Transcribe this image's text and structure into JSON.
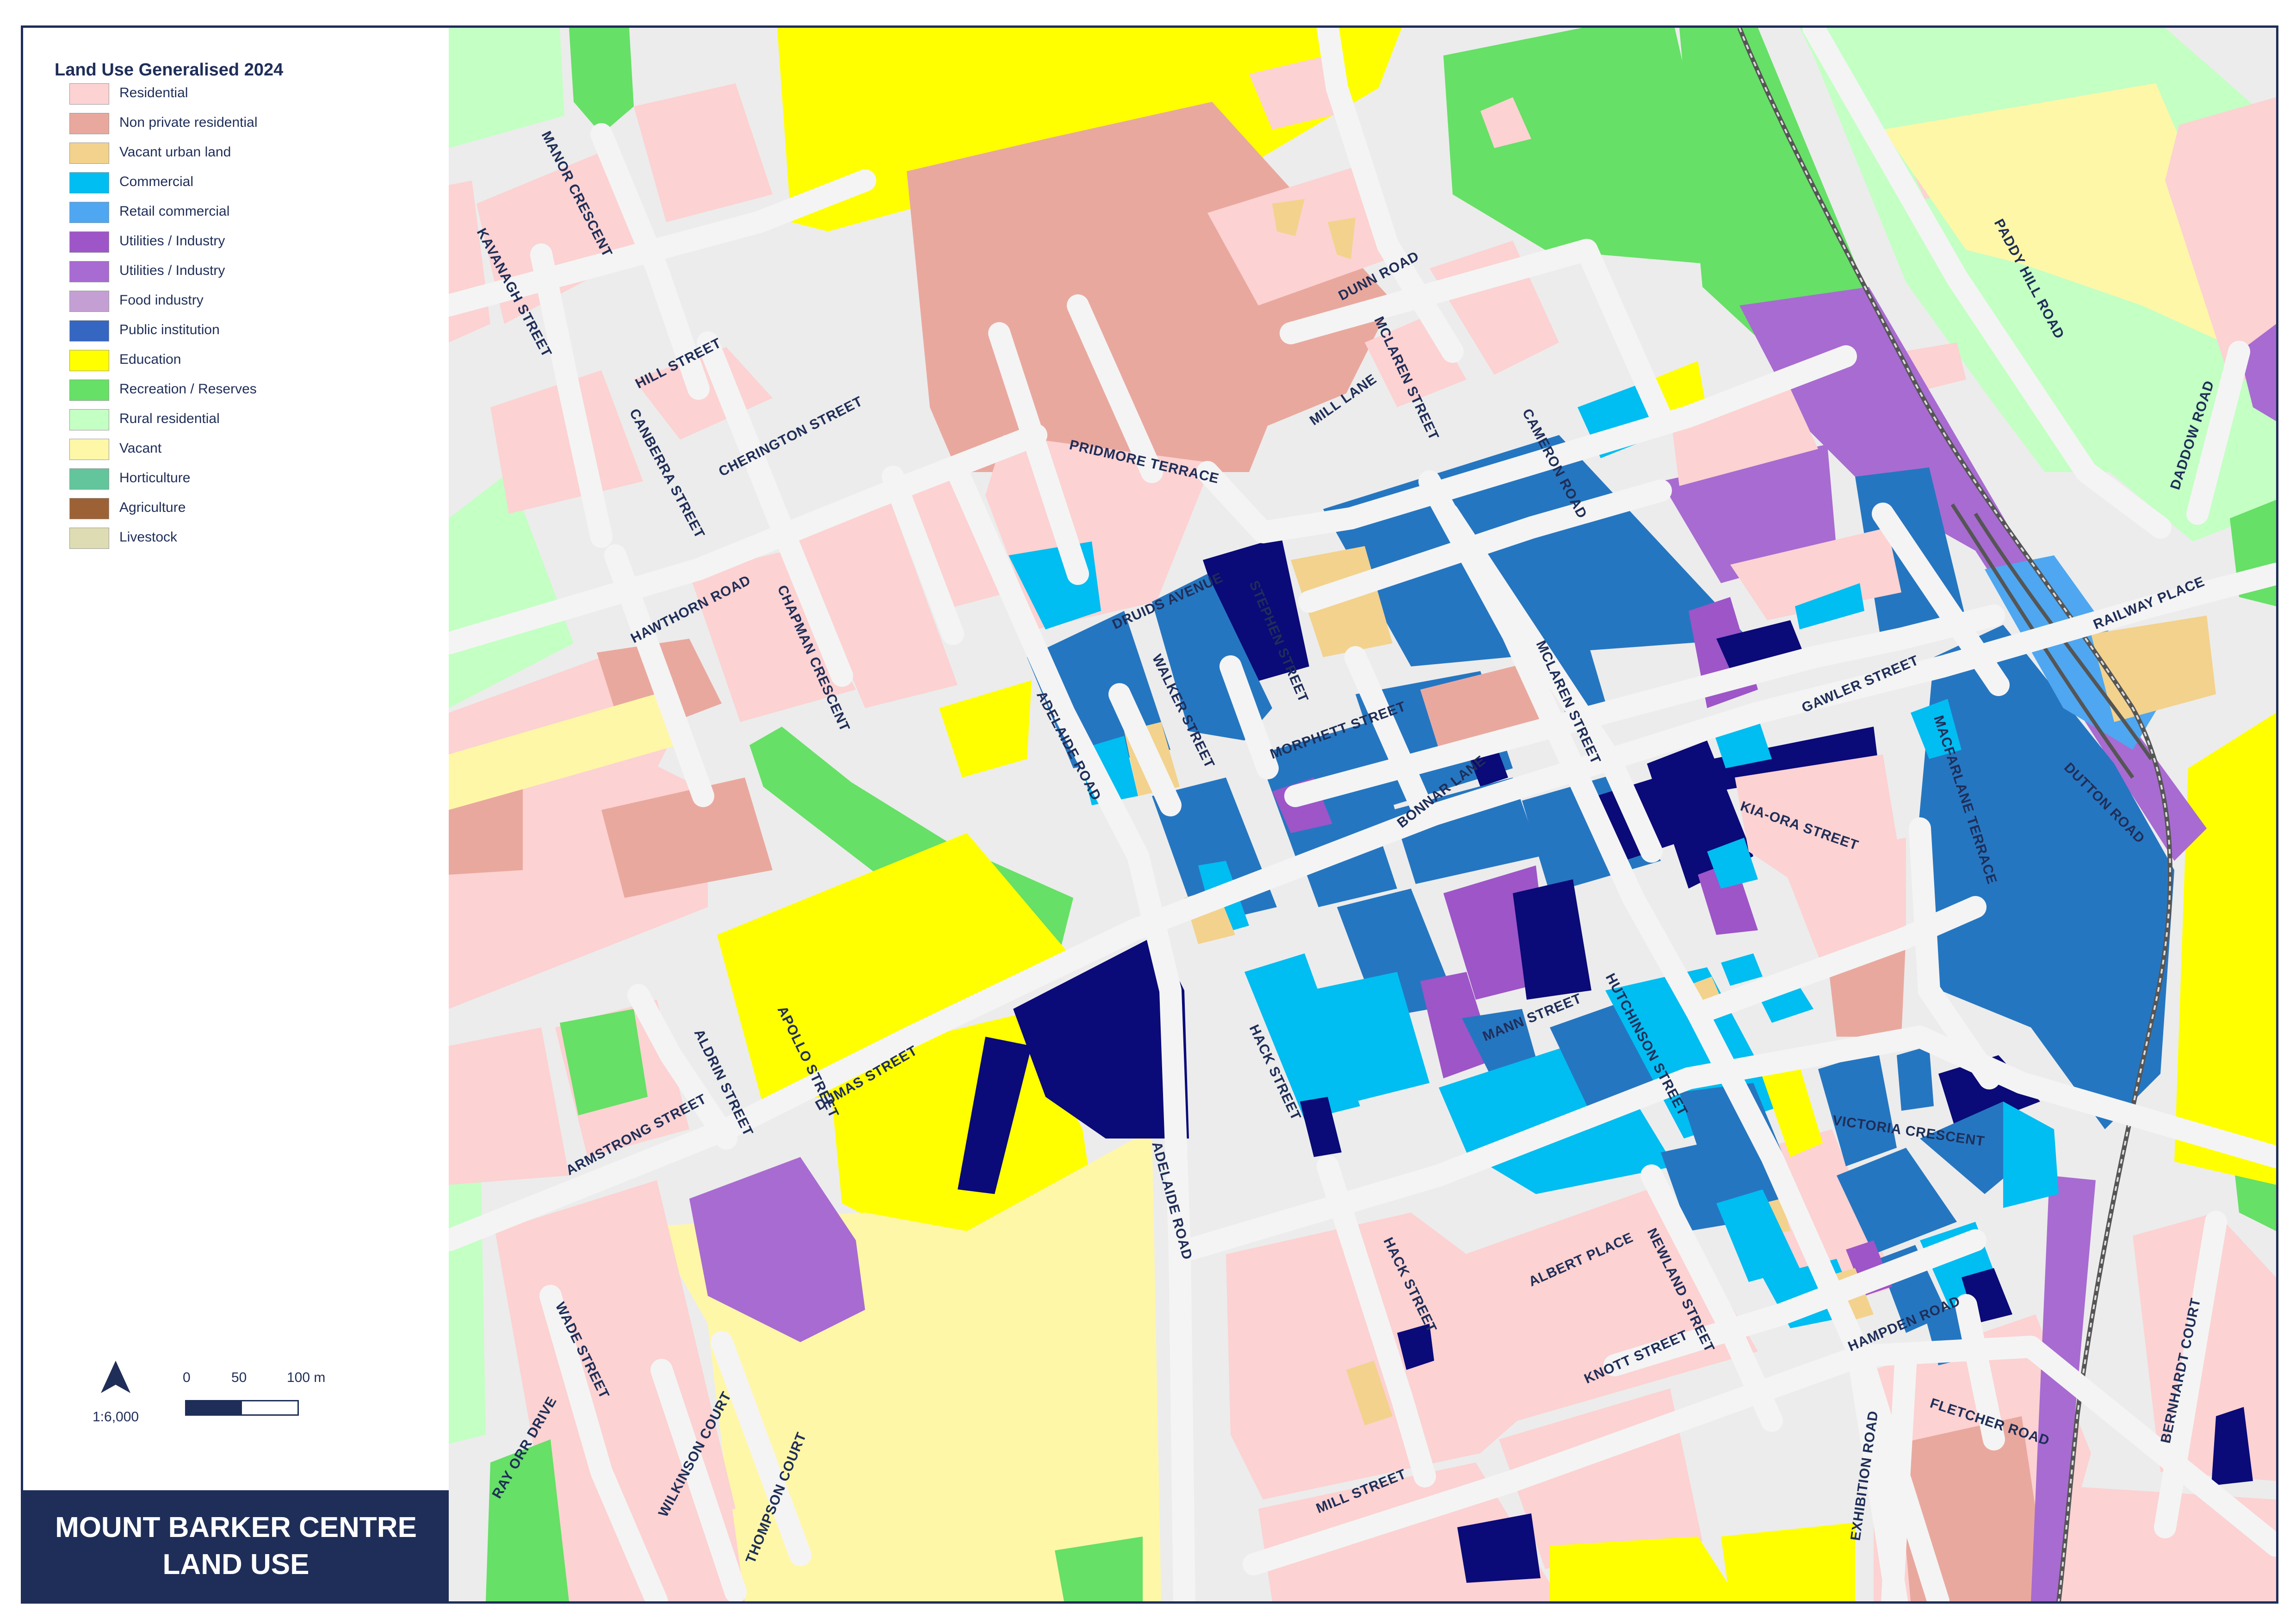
{
  "legend": {
    "title": "Land Use Generalised 2024",
    "items": [
      {
        "label": "Residential",
        "color": "#fcd2d2"
      },
      {
        "label": "Non private residential",
        "color": "#e9a89e"
      },
      {
        "label": "Vacant urban land",
        "color": "#f3d28d"
      },
      {
        "label": "Commercial",
        "color": "#00bdf2"
      },
      {
        "label": "Retail commercial",
        "color": "#4ea7f0"
      },
      {
        "label": "Utilities / Industry",
        "color": "#9d55c8"
      },
      {
        "label": "Utilities / Industry",
        "color": "#a86bd1"
      },
      {
        "label": "Food industry",
        "color": "#c49fd3"
      },
      {
        "label": "Public institution",
        "color": "#3566c1"
      },
      {
        "label": "Education",
        "color": "#ffff00"
      },
      {
        "label": "Recreation / Reserves",
        "color": "#66e066"
      },
      {
        "label": "Rural residential",
        "color": "#c4ffc4"
      },
      {
        "label": "Vacant",
        "color": "#fff7a8"
      },
      {
        "label": "Horticulture",
        "color": "#62c59c"
      },
      {
        "label": "Agriculture",
        "color": "#9c6236"
      },
      {
        "label": "Livestock",
        "color": "#dedcb2"
      }
    ]
  },
  "scale": {
    "ratio": "1:6,000",
    "ticks": [
      "0",
      "50",
      "100 m"
    ]
  },
  "north_arrow_icon": "north-arrow-icon",
  "title": {
    "line1": "MOUNT BARKER CENTRE",
    "line2": "LAND USE"
  },
  "streets": [
    "MANOR CRESCENT",
    "KAVANAGH STREET",
    "HILL STREET",
    "CANBERRA STREET",
    "CHERINGTON STREET",
    "HAWTHORN ROAD",
    "CHAPMAN CRESCENT",
    "PRIDMORE TERRACE",
    "DRUIDS AVENUE",
    "WALKER STREET",
    "STEPHEN STREET",
    "DUNN ROAD",
    "MCLAREN STREET",
    "MILL LANE",
    "CAMERON ROAD",
    "PADDY HILL ROAD",
    "DADDOW ROAD",
    "RAILWAY PLACE",
    "GAWLER STREET",
    "MORPHETT STREET",
    "ADELAIDE ROAD",
    "BONNAR LANE",
    "MACFARLANE TERRACE",
    "KIA-ORA STREET",
    "DUTTON ROAD",
    "MANN STREET",
    "HUTCHINSON STREET",
    "HACK STREET",
    "APOLLO STREET",
    "ALDRIN STREET",
    "ARMSTRONG STREET",
    "DUMAS STREET",
    "VICTORIA CRESCENT",
    "ALBERT PLACE",
    "NEWLAND STREET",
    "KNOTT STREET",
    "HAMPDEN ROAD",
    "FLETCHER ROAD",
    "EXHIBITION ROAD",
    "BERNHARDT COURT",
    "WADE STREET",
    "RAY ORR DRIVE",
    "WILKINSON COURT",
    "THOMPSON COURT",
    "MILL STREET"
  ]
}
